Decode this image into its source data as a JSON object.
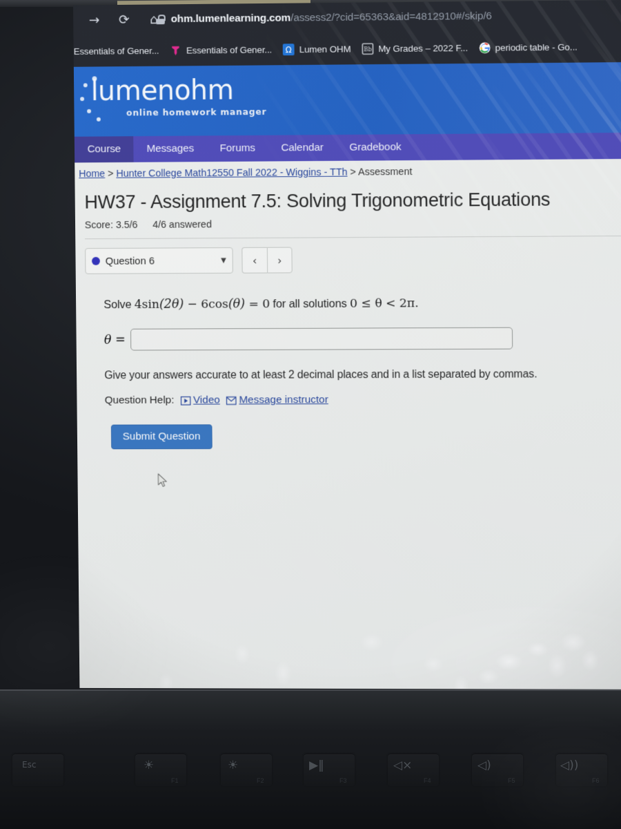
{
  "browser": {
    "nav_icons": [
      {
        "name": "back-icon",
        "glyph": "←"
      },
      {
        "name": "forward-icon",
        "glyph": "→"
      },
      {
        "name": "reload-icon",
        "glyph": "⟳"
      },
      {
        "name": "home-icon",
        "glyph": "⌂"
      }
    ],
    "url_host": "ohm.lumenlearning.com",
    "url_path": "/assess2/?cid=65363&aid=4812910#/skip/6",
    "bookmarks": [
      {
        "label": "Essentials of Gener...",
        "icon": "pin-icon",
        "color": "#e0218a"
      },
      {
        "label": "Essentials of Gener...",
        "icon": "pin-icon",
        "color": "#e0218a"
      },
      {
        "label": "Lumen OHM",
        "icon": "omega-icon",
        "color": "#1a6fd4"
      },
      {
        "label": "My Grades – 2022 F...",
        "icon": "blackboard-icon",
        "color": "#d8dce3"
      },
      {
        "label": "periodic table - Go...",
        "icon": "google-icon",
        "color": "#4285f4"
      }
    ]
  },
  "site": {
    "logo_word": "lumenohm",
    "logo_tagline": "online homework manager",
    "header_color": "#1c5cc0",
    "nav_color": "#4a45b7",
    "nav_active_color": "#3b3793"
  },
  "nav": {
    "tabs": [
      {
        "label": "Course",
        "active": true
      },
      {
        "label": "Messages",
        "active": false
      },
      {
        "label": "Forums",
        "active": false
      },
      {
        "label": "Calendar",
        "active": false
      },
      {
        "label": "Gradebook",
        "active": false
      }
    ]
  },
  "breadcrumb": {
    "home": "Home",
    "sep1": " > ",
    "course": "Hunter College Math12550 Fall 2022 - Wiggins - TTh",
    "sep2": " > ",
    "current": "Assessment"
  },
  "assessment": {
    "title": "HW37 - Assignment 7.5: Solving Trigonometric Equations",
    "score": "Score: 3.5/6",
    "answered": "4/6 answered"
  },
  "question_picker": {
    "selected": "Question 6",
    "caret": "▼",
    "status_dot_color": "#2a2ab8",
    "prev": "‹",
    "next": "›"
  },
  "question": {
    "prompt_prefix": "Solve ",
    "coef1": "4",
    "fn1": "sin",
    "arg1": "(2θ)",
    "minus": " − ",
    "coef2": "6",
    "fn2": "cos",
    "arg2": "(θ)",
    "equals": " = ",
    "rhs": "0",
    "prompt_suffix": " for all solutions ",
    "domain": "0 ≤ θ < 2π.",
    "answer_label": "θ =",
    "answer_value": "",
    "answer_placeholder": "",
    "hint": "Give your answers accurate to at least 2 decimal places and in a list separated by commas.",
    "help_label": "Question Help:",
    "help_video": "Video",
    "help_message": "Message instructor",
    "submit_label": "Submit Question",
    "submit_color": "#3272c0"
  },
  "keyboard": {
    "keys": [
      {
        "label": "Esc",
        "glyph": "",
        "fn": ""
      },
      {
        "label": "",
        "glyph": "☀",
        "fn": "F1"
      },
      {
        "label": "",
        "glyph": "☀",
        "fn": "F2"
      },
      {
        "label": "",
        "glyph": "▶‖",
        "fn": "F3"
      },
      {
        "label": "",
        "glyph": "◁×",
        "fn": "F4"
      },
      {
        "label": "",
        "glyph": "◁)",
        "fn": "F5"
      },
      {
        "label": "",
        "glyph": "◁))",
        "fn": "F6"
      }
    ]
  }
}
